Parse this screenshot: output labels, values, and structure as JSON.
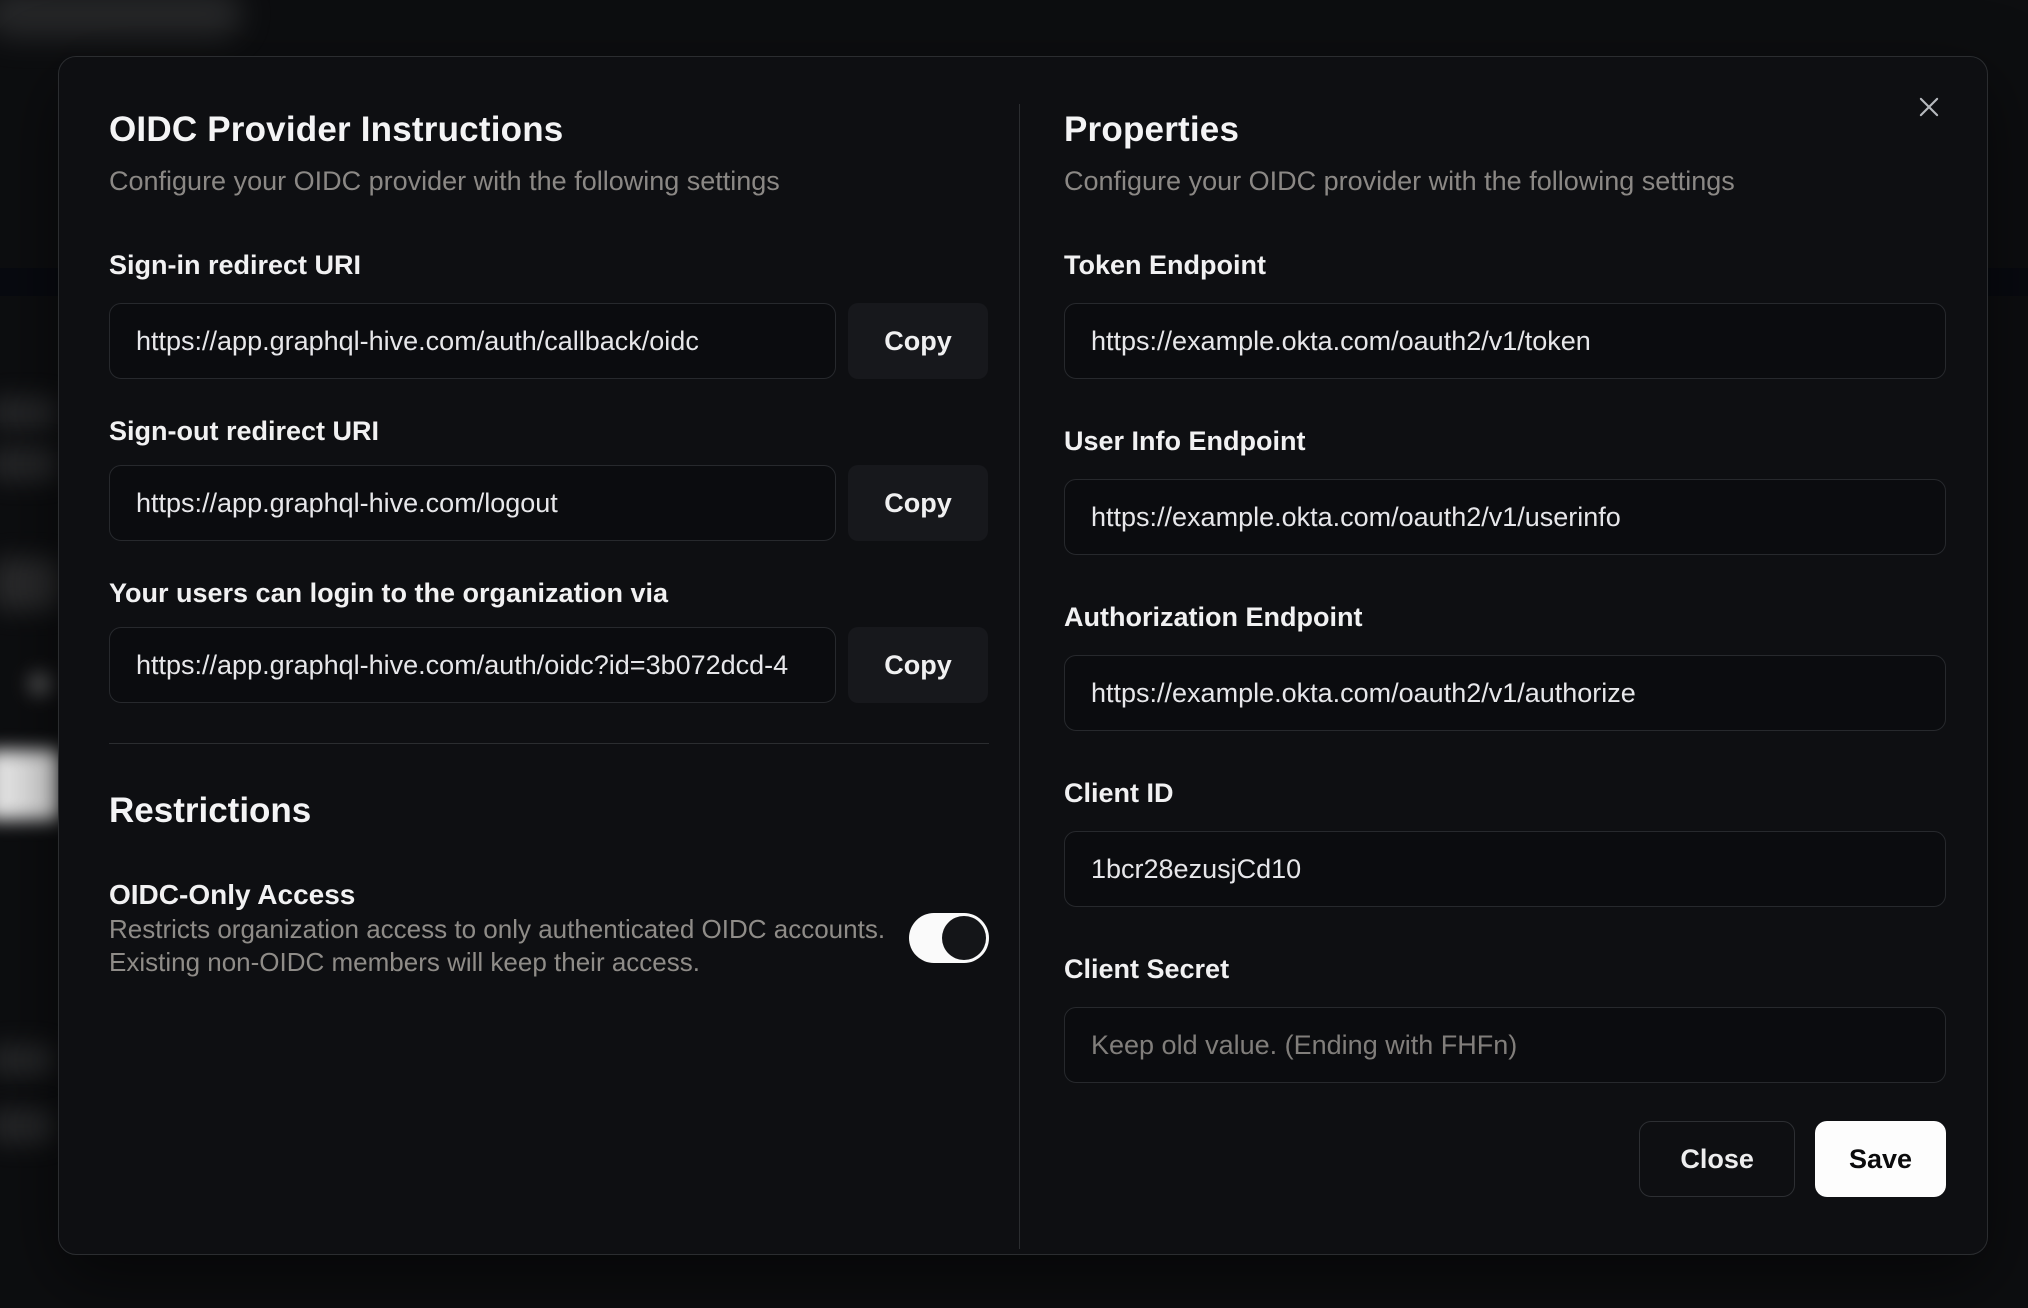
{
  "dialog": {
    "close_icon": "x-icon",
    "left": {
      "title": "OIDC Provider Instructions",
      "subtitle": "Configure your OIDC provider with the following settings",
      "fields": [
        {
          "label": "Sign-in redirect URI",
          "value": "https://app.graphql-hive.com/auth/callback/oidc",
          "copy_label": "Copy"
        },
        {
          "label": "Sign-out redirect URI",
          "value": "https://app.graphql-hive.com/logout",
          "copy_label": "Copy"
        },
        {
          "label": "Your users can login to the organization via",
          "value": "https://app.graphql-hive.com/auth/oidc?id=3b072dcd-4",
          "copy_label": "Copy"
        }
      ],
      "restrictions": {
        "title": "Restrictions",
        "oidc_only": {
          "label": "OIDC-Only Access",
          "description_line1": "Restricts organization access to only authenticated OIDC accounts.",
          "description_line2": "Existing non-OIDC members will keep their access.",
          "state": "on"
        }
      }
    },
    "right": {
      "title": "Properties",
      "subtitle": "Configure your OIDC provider with the following settings",
      "fields": [
        {
          "label": "Token Endpoint",
          "value": "https://example.okta.com/oauth2/v1/token"
        },
        {
          "label": "User Info Endpoint",
          "value": "https://example.okta.com/oauth2/v1/userinfo"
        },
        {
          "label": "Authorization Endpoint",
          "value": "https://example.okta.com/oauth2/v1/authorize"
        },
        {
          "label": "Client ID",
          "value": "1bcr28ezusjCd10"
        },
        {
          "label": "Client Secret",
          "value": "",
          "placeholder": "Keep old value. (Ending with FHFn)"
        }
      ],
      "footer": {
        "close_label": "Close",
        "save_label": "Save"
      }
    },
    "colors": {
      "modal_background": "#0e0f12",
      "page_background": "#0d0e10",
      "border": "#2b2d30",
      "input_border": "#27292d",
      "heading_text": "#f4f4f5",
      "muted_text": "#8b8885",
      "toggle_on": "#fafafa",
      "save_button": "#fdfdfd"
    }
  }
}
